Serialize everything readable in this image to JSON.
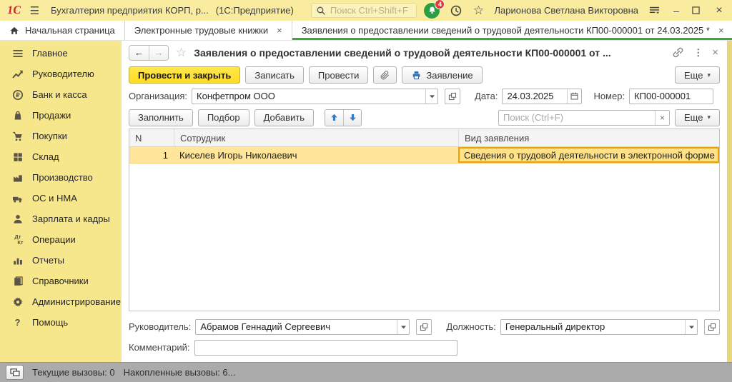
{
  "titlebar": {
    "logo": "1С",
    "app_title": "Бухгалтерия предприятия КОРП, р...",
    "app_suffix": "(1С:Предприятие)",
    "search_placeholder": "Поиск Ctrl+Shift+F",
    "notification_badge": "4",
    "user_name": "Ларионова Светлана Викторовна"
  },
  "tabs": {
    "home": "Начальная страница",
    "books": "Электронные трудовые книжки",
    "statement": "Заявления о предоставлении сведений о трудовой деятельности КП00-000001 от 24.03.2025 *"
  },
  "sidebar": {
    "items": [
      {
        "label": "Главное",
        "icon": "menu-icon"
      },
      {
        "label": "Руководителю",
        "icon": "trend-icon"
      },
      {
        "label": "Банк и касса",
        "icon": "ruble-icon"
      },
      {
        "label": "Продажи",
        "icon": "bag-icon"
      },
      {
        "label": "Покупки",
        "icon": "cart-icon"
      },
      {
        "label": "Склад",
        "icon": "pallet-icon"
      },
      {
        "label": "Производство",
        "icon": "factory-icon"
      },
      {
        "label": "ОС и НМА",
        "icon": "truck-icon"
      },
      {
        "label": "Зарплата и кадры",
        "icon": "person-icon"
      },
      {
        "label": "Операции",
        "icon": "dtkt-icon",
        "icon_top": "Дт",
        "icon_bottom": "Кт"
      },
      {
        "label": "Отчеты",
        "icon": "bar-chart-icon"
      },
      {
        "label": "Справочники",
        "icon": "book-icon"
      },
      {
        "label": "Администрирование",
        "icon": "gear-icon"
      },
      {
        "label": "Помощь",
        "icon": "question-icon"
      }
    ]
  },
  "document": {
    "title": "Заявления о предоставлении сведений о трудовой деятельности КП00-000001 от ...",
    "toolbar": {
      "post_and_close": "Провести и закрыть",
      "write": "Записать",
      "post": "Провести",
      "statement": "Заявление",
      "more": "Еще"
    },
    "header_fields": {
      "organization_label": "Организация:",
      "organization_value": "Конфетпром ООО",
      "date_label": "Дата:",
      "date_value": "24.03.2025",
      "number_label": "Номер:",
      "number_value": "КП00-000001"
    },
    "table_toolbar": {
      "fill": "Заполнить",
      "pick": "Подбор",
      "add": "Добавить",
      "search_placeholder": "Поиск (Ctrl+F)",
      "more": "Еще"
    },
    "table": {
      "columns": {
        "n": "N",
        "employee": "Сотрудник",
        "kind": "Вид заявления"
      },
      "rows": [
        {
          "n": "1",
          "employee": "Киселев Игорь Николаевич",
          "kind": "Сведения о трудовой деятельности в электронной форме"
        }
      ]
    },
    "footer_fields": {
      "manager_label": "Руководитель:",
      "manager_value": "Абрамов Геннадий Сергеевич",
      "position_label": "Должность:",
      "position_value": "Генеральный директор",
      "comment_label": "Комментарий:",
      "comment_value": ""
    }
  },
  "statusbar": {
    "current_calls": "Текущие вызовы: 0",
    "accumulated_calls": "Накопленные вызовы: 6..."
  },
  "glyphs": {
    "close": "×",
    "minimize": "–",
    "kebab": "⋮",
    "star": "☆",
    "back": "←",
    "forward": "→",
    "caret_down": "▾",
    "hamburger": "☰"
  },
  "colors": {
    "titlebar_bg": "#FAEC9E",
    "sidebar_bg": "#F6E68C",
    "primary_button_bg": "#FFDB24",
    "selection_bg": "#FFE69B",
    "selection_border": "#E8A400",
    "active_tab_underline": "#3BA83B",
    "statusbar_bg": "#ABABAB",
    "logo_red": "#D8232A",
    "notification_green": "#2E9E44",
    "badge_red": "#E53935",
    "arrow_blue": "#2F7CC4"
  }
}
